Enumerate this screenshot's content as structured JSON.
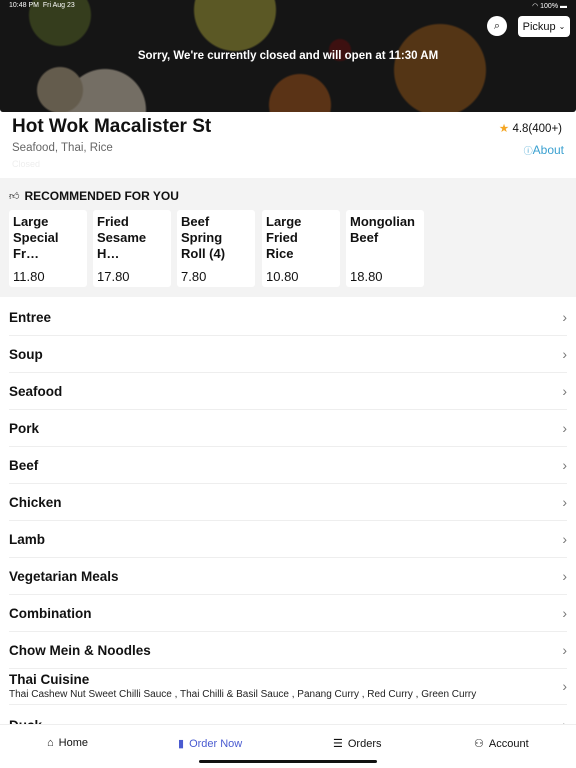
{
  "status": {
    "time": "10:48 PM",
    "date": "Fri Aug 23",
    "battery": "100%"
  },
  "hero": {
    "message": "Sorry, We're currently closed and will open at 11:30 AM",
    "mode": "Pickup"
  },
  "store": {
    "name": "Hot Wok Macalister St",
    "cuisine": "Seafood, Thai, Rice",
    "status": "Closed",
    "rating": "4.8(400+)",
    "about": "About"
  },
  "recommended": {
    "title": "RECOMMENDED FOR YOU",
    "items": [
      {
        "name": "Large\nSpecial Fr…",
        "price": "11.80"
      },
      {
        "name": "Fried\nSesame H…",
        "price": "17.80"
      },
      {
        "name": "Beef Spring\nRoll (4)",
        "price": "7.80"
      },
      {
        "name": "Large Fried\nRice",
        "price": "10.80"
      },
      {
        "name": "Mongolian\nBeef",
        "price": "18.80"
      }
    ]
  },
  "categories": [
    "Entree",
    "Soup",
    "Seafood",
    "Pork",
    "Beef",
    "Chicken",
    "Lamb",
    "Vegetarian Meals",
    "Combination",
    "Chow Mein & Noodles"
  ],
  "thai": {
    "name": "Thai Cuisine",
    "desc": "Thai Cashew Nut Sweet Chilli Sauce , Thai Chilli & Basil Sauce , Panang Curry , Red Curry , Green Curry"
  },
  "partial": "Duck",
  "nav": {
    "home": "Home",
    "order": "Order Now",
    "orders": "Orders",
    "account": "Account",
    "accent": "#4a5bd0"
  }
}
